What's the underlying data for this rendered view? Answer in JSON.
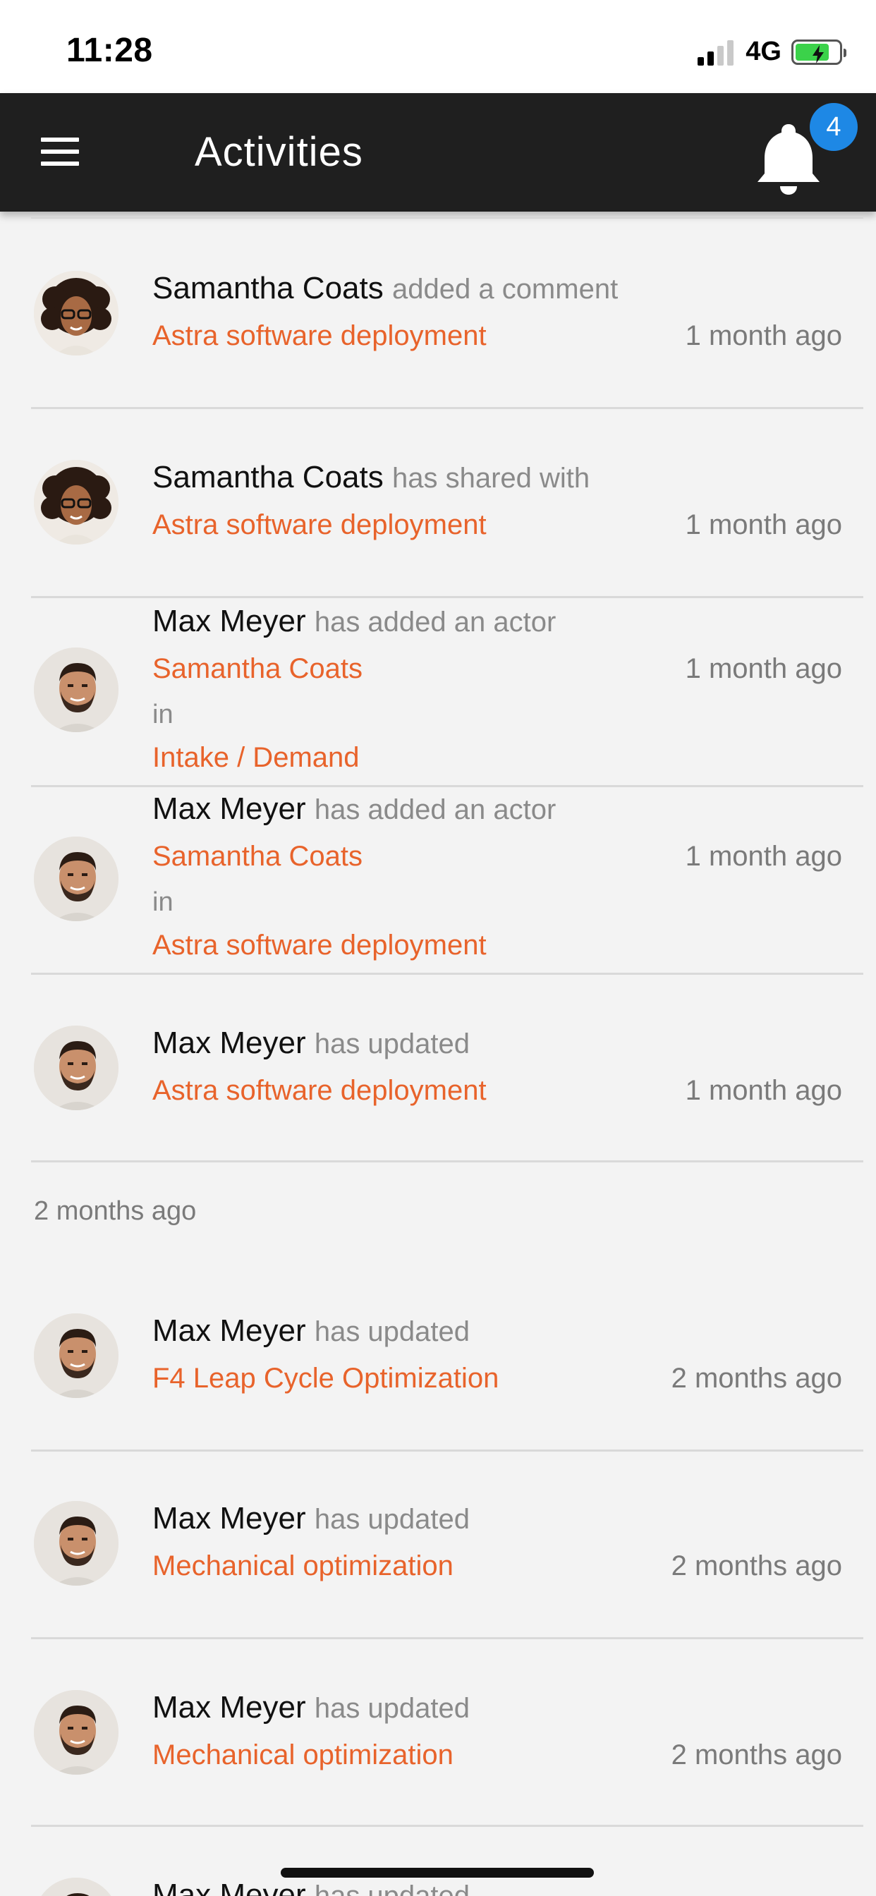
{
  "status_bar": {
    "time": "11:28",
    "network": "4G"
  },
  "app_bar": {
    "title": "Activities",
    "notification_count": "4"
  },
  "activities": [
    {
      "actor": "Samantha Coats",
      "action": "added a comment",
      "target": "Astra software deployment",
      "time": "1 month ago",
      "avatar": "samantha"
    },
    {
      "actor": "Samantha Coats",
      "action": "has shared with",
      "target": "Astra software deployment",
      "time": "1 month ago",
      "avatar": "samantha"
    },
    {
      "actor": "Max Meyer",
      "action": "has added an actor",
      "target": "Samantha Coats",
      "in_label": "in",
      "in_target": "Intake / Demand",
      "time": "1 month ago",
      "avatar": "max"
    },
    {
      "actor": "Max Meyer",
      "action": "has added an actor",
      "target": "Samantha Coats",
      "in_label": "in",
      "in_target": "Astra software deployment",
      "time": "1 month ago",
      "avatar": "max"
    },
    {
      "actor": "Max Meyer",
      "action": "has updated",
      "target": "Astra software deployment",
      "time": "1 month ago",
      "avatar": "max"
    },
    {
      "actor": "Max Meyer",
      "action": "has updated",
      "target": "F4 Leap Cycle Optimization",
      "time": "2 months ago",
      "avatar": "max"
    },
    {
      "actor": "Max Meyer",
      "action": "has updated",
      "target": "Mechanical optimization",
      "time": "2 months ago",
      "avatar": "max"
    },
    {
      "actor": "Max Meyer",
      "action": "has updated",
      "target": "Mechanical optimization",
      "time": "2 months ago",
      "avatar": "max"
    },
    {
      "actor": "Max Meyer",
      "action": "has updated",
      "avatar": "max"
    }
  ],
  "section_header": "2 months ago",
  "colors": {
    "app_bar": "#1f1f1f",
    "link": "#e8632b",
    "badge": "#1e88e5",
    "background": "#f3f3f3"
  },
  "icons": {
    "menu": "hamburger-icon",
    "notifications": "bell-icon"
  }
}
